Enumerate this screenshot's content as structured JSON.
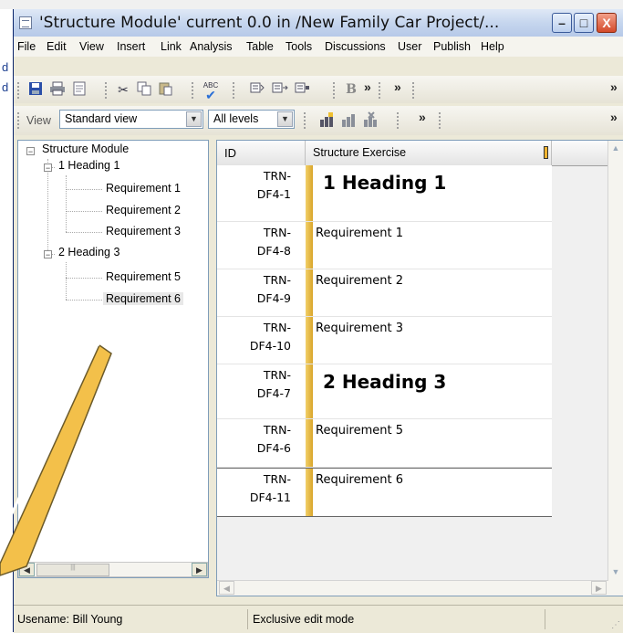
{
  "background": {
    "fragments": [
      "d",
      "d"
    ]
  },
  "window": {
    "title": "'Structure Module' current 0.0 in /New Family Car Project/...",
    "buttons": {
      "minimize": "–",
      "maximize": "□",
      "close": "X"
    }
  },
  "menu": [
    {
      "label": "File"
    },
    {
      "label": "Edit"
    },
    {
      "label": "View"
    },
    {
      "label": "Insert"
    },
    {
      "label": "Link"
    },
    {
      "label": "Analysis"
    },
    {
      "label": "Table"
    },
    {
      "label": "Tools"
    },
    {
      "label": "Discussions"
    },
    {
      "label": "User"
    },
    {
      "label": "Publish"
    },
    {
      "label": "Help"
    }
  ],
  "toolbar": {
    "more": "»",
    "bold_glyph": "B",
    "spell_glyph": "ABC"
  },
  "view_toolbar": {
    "view_label": "View",
    "view_select": "Standard view",
    "levels_select": "All levels"
  },
  "tree": {
    "root": "Structure Module",
    "nodes": [
      {
        "label": "1 Heading 1",
        "children": [
          "Requirement 1",
          "Requirement 2",
          "Requirement 3"
        ]
      },
      {
        "label": "2 Heading 3",
        "children": [
          "Requirement 5",
          "Requirement 6"
        ]
      }
    ]
  },
  "grid": {
    "columns": [
      "ID",
      "Structure Exercise"
    ],
    "rows": [
      {
        "id_line1": "TRN-",
        "id_line2": "DF4-1",
        "text": "1 Heading 1",
        "kind": "heading"
      },
      {
        "id_line1": "TRN-",
        "id_line2": "DF4-8",
        "text": "Requirement 1",
        "kind": "req"
      },
      {
        "id_line1": "TRN-",
        "id_line2": "DF4-9",
        "text": "Requirement 2",
        "kind": "req"
      },
      {
        "id_line1": "TRN-",
        "id_line2": "DF4-10",
        "text": "Requirement 3",
        "kind": "req"
      },
      {
        "id_line1": "TRN-",
        "id_line2": "DF4-7",
        "text": "2 Heading 3",
        "kind": "heading"
      },
      {
        "id_line1": "TRN-",
        "id_line2": "DF4-6",
        "text": "Requirement 5",
        "kind": "req"
      },
      {
        "id_line1": "TRN-",
        "id_line2": "DF4-11",
        "text": "Requirement 6",
        "kind": "req"
      }
    ]
  },
  "status": {
    "username": "Usename: Bill Young",
    "mode": "Exclusive edit mode"
  },
  "colors": {
    "bar": "#e0b040",
    "callout": "#f3c04a"
  }
}
